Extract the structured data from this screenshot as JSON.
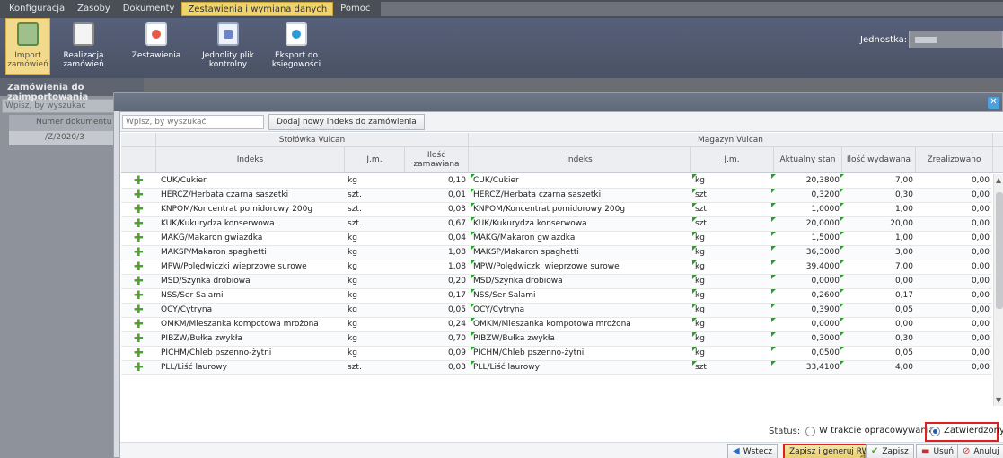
{
  "menu": [
    "Konfiguracja",
    "Zasoby",
    "Dokumenty",
    "Zestawienia i wymiana danych",
    "Pomoc"
  ],
  "ribbon": {
    "buttons": [
      {
        "label": "Import zamówień",
        "icon": "import-orders-icon"
      },
      {
        "label": "Realizacja zamówień",
        "icon": "order-realization-icon"
      },
      {
        "label": "Zestawienia",
        "icon": "reports-icon"
      },
      {
        "label": "Jednolity plik kontrolny",
        "icon": "jpk-file-icon"
      },
      {
        "label": "Eksport do księgowości",
        "icon": "export-accounting-icon"
      }
    ],
    "unit_label": "Jednostka:"
  },
  "left_panel": {
    "title": "Zamówienia do zaimportowania",
    "search_placeholder": "Wpisz, by wyszukać",
    "col_number": "Numer dokumentu",
    "row_value": "/Z/2020/3"
  },
  "dialog": {
    "search_placeholder": "Wpisz, by wyszukać",
    "add_button": "Dodaj nowy indeks do zamówienia",
    "group_left": "Stołówka Vulcan",
    "group_right": "Magazyn Vulcan",
    "columns": {
      "indeks": "Indeks",
      "jm": "J.m.",
      "ilosc_zam": "Ilość zamawiana",
      "indeks2": "Indeks",
      "jm2": "J.m.",
      "stan": "Aktualny stan",
      "wydawana": "Ilość wydawana",
      "zrealizowano": "Zrealizowano"
    },
    "rows": [
      {
        "idx": "CUK/Cukier",
        "jm": "kg",
        "qty": "0,10",
        "idx2": "CUK/Cukier",
        "jm2": "kg",
        "stan": "20,3800",
        "wyd": "7,00",
        "zr": "0,00"
      },
      {
        "idx": "HERCZ/Herbata czarna saszetki",
        "jm": "szt.",
        "qty": "0,01",
        "idx2": "HERCZ/Herbata czarna saszetki",
        "jm2": "szt.",
        "stan": "0,3200",
        "wyd": "0,30",
        "zr": "0,00"
      },
      {
        "idx": "KNPOM/Koncentrat pomidorowy 200g",
        "jm": "szt.",
        "qty": "0,03",
        "idx2": "KNPOM/Koncentrat pomidorowy 200g",
        "jm2": "szt.",
        "stan": "1,0000",
        "wyd": "1,00",
        "zr": "0,00"
      },
      {
        "idx": "KUK/Kukurydza konserwowa",
        "jm": "szt.",
        "qty": "0,67",
        "idx2": "KUK/Kukurydza konserwowa",
        "jm2": "szt.",
        "stan": "20,0000",
        "wyd": "20,00",
        "zr": "0,00"
      },
      {
        "idx": "MAKG/Makaron gwiazdka",
        "jm": "kg",
        "qty": "0,04",
        "idx2": "MAKG/Makaron gwiazdka",
        "jm2": "kg",
        "stan": "1,5000",
        "wyd": "1,00",
        "zr": "0,00"
      },
      {
        "idx": "MAKSP/Makaron spaghetti",
        "jm": "kg",
        "qty": "1,08",
        "idx2": "MAKSP/Makaron spaghetti",
        "jm2": "kg",
        "stan": "36,3000",
        "wyd": "3,00",
        "zr": "0,00"
      },
      {
        "idx": "MPW/Polędwiczki wieprzowe surowe",
        "jm": "kg",
        "qty": "1,08",
        "idx2": "MPW/Polędwiczki wieprzowe surowe",
        "jm2": "kg",
        "stan": "39,4000",
        "wyd": "7,00",
        "zr": "0,00"
      },
      {
        "idx": "MSD/Szynka drobiowa",
        "jm": "kg",
        "qty": "0,20",
        "idx2": "MSD/Szynka drobiowa",
        "jm2": "kg",
        "stan": "0,0000",
        "wyd": "0,00",
        "zr": "0,00"
      },
      {
        "idx": "NSS/Ser Salami",
        "jm": "kg",
        "qty": "0,17",
        "idx2": "NSS/Ser Salami",
        "jm2": "kg",
        "stan": "0,2600",
        "wyd": "0,17",
        "zr": "0,00"
      },
      {
        "idx": "OCY/Cytryna",
        "jm": "kg",
        "qty": "0,05",
        "idx2": "OCY/Cytryna",
        "jm2": "kg",
        "stan": "0,3900",
        "wyd": "0,05",
        "zr": "0,00"
      },
      {
        "idx": "OMKM/Mieszanka kompotowa mrożona",
        "jm": "kg",
        "qty": "0,24",
        "idx2": "OMKM/Mieszanka kompotowa mrożona",
        "jm2": "kg",
        "stan": "0,0000",
        "wyd": "0,00",
        "zr": "0,00"
      },
      {
        "idx": "PIBZW/Bułka zwykła",
        "jm": "kg",
        "qty": "0,70",
        "idx2": "PIBZW/Bułka zwykła",
        "jm2": "kg",
        "stan": "0,3000",
        "wyd": "0,30",
        "zr": "0,00"
      },
      {
        "idx": "PICHM/Chleb pszenno-żytni",
        "jm": "kg",
        "qty": "0,09",
        "idx2": "PICHM/Chleb pszenno-żytni",
        "jm2": "kg",
        "stan": "0,0500",
        "wyd": "0,05",
        "zr": "0,00"
      },
      {
        "idx": "PLL/Liść laurowy",
        "jm": "szt.",
        "qty": "0,03",
        "idx2": "PLL/Liść laurowy",
        "jm2": "szt.",
        "stan": "33,4100",
        "wyd": "4,00",
        "zr": "0,00"
      }
    ],
    "status_label": "Status:",
    "status_options": [
      "W trakcie opracowywania",
      "Zatwierdzony"
    ],
    "status_selected": "Zatwierdzony",
    "buttons": {
      "back": "Wstecz",
      "save_generate": "Zapisz i generuj RW",
      "save": "Zapisz",
      "delete": "Usuń",
      "cancel": "Anuluj"
    }
  }
}
